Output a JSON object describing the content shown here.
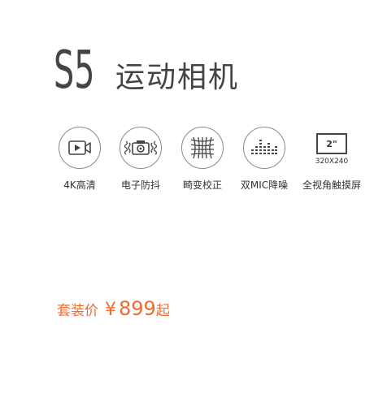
{
  "title": {
    "model": "S5",
    "product": "运动相机"
  },
  "features": [
    {
      "icon": "video-camera-icon",
      "label": "4K高清"
    },
    {
      "icon": "stabilized-camera-icon",
      "label": "电子防抖"
    },
    {
      "icon": "distortion-grid-icon",
      "label": "畸变校正"
    },
    {
      "icon": "equalizer-icon",
      "label": "双MIC降噪"
    },
    {
      "icon": "touchscreen-icon",
      "label": "全视角触摸屏",
      "screen_size": "2\"",
      "resolution": "320X240"
    }
  ],
  "price": {
    "label": "套装价",
    "currency": "¥",
    "value": "899",
    "suffix": "起",
    "color": "#f26b2b"
  }
}
